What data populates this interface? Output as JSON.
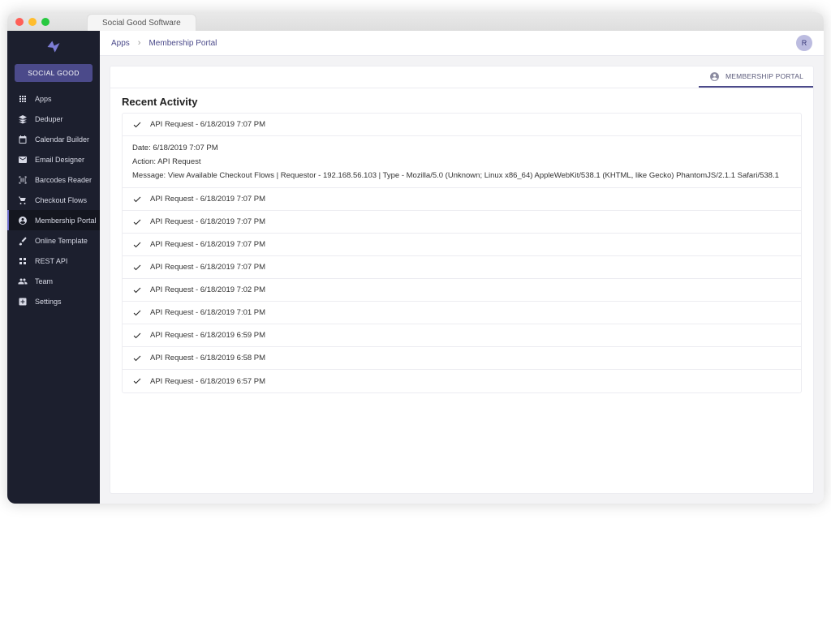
{
  "browser_tab": "Social Good Software",
  "brand_button": "SOCIAL GOOD",
  "nav": [
    {
      "label": "Apps"
    },
    {
      "label": "Deduper"
    },
    {
      "label": "Calendar Builder"
    },
    {
      "label": "Email Designer"
    },
    {
      "label": "Barcodes Reader"
    },
    {
      "label": "Checkout Flows"
    },
    {
      "label": "Membership Portal"
    },
    {
      "label": "Online Template"
    },
    {
      "label": "REST API"
    },
    {
      "label": "Team"
    },
    {
      "label": "Settings"
    }
  ],
  "breadcrumb": {
    "root": "Apps",
    "current": "Membership Portal"
  },
  "avatar_initial": "R",
  "card_tab": "MEMBERSHIP PORTAL",
  "section_title": "Recent Activity",
  "detail": {
    "date_label": "Date:",
    "date_value": "6/18/2019 7:07 PM",
    "action_label": "Action:",
    "action_value": "API Request",
    "message_label": "Message:",
    "message_value": "View Available Checkout Flows | Requestor - 192.168.56.103 | Type - Mozilla/5.0 (Unknown; Linux x86_64) AppleWebKit/538.1 (KHTML, like Gecko) PhantomJS/2.1.1 Safari/538.1"
  },
  "rows": [
    "API Request - 6/18/2019 7:07 PM",
    "API Request - 6/18/2019 7:07 PM",
    "API Request - 6/18/2019 7:07 PM",
    "API Request - 6/18/2019 7:07 PM",
    "API Request - 6/18/2019 7:07 PM",
    "API Request - 6/18/2019 7:02 PM",
    "API Request - 6/18/2019 7:01 PM",
    "API Request - 6/18/2019 6:59 PM",
    "API Request - 6/18/2019 6:58 PM",
    "API Request - 6/18/2019 6:57 PM"
  ]
}
